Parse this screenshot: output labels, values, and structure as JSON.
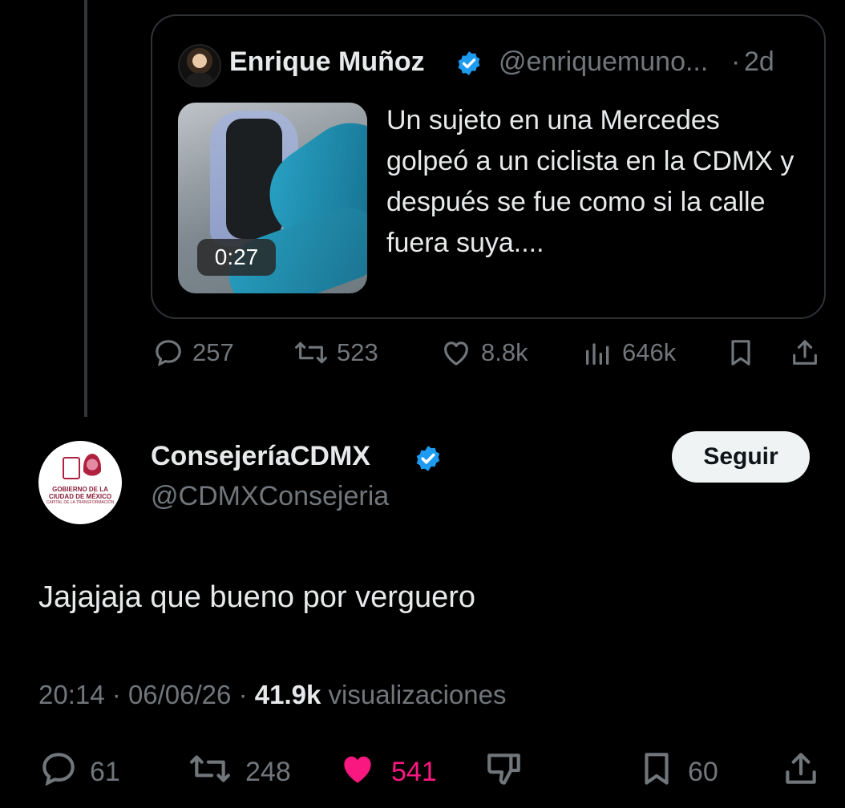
{
  "quoted_tweet": {
    "author_name": "Enrique Muñoz",
    "handle": "@enriquemuno...",
    "separator": "·",
    "time_ago": "2d",
    "video_duration": "0:27",
    "text": "Un sujeto en una Mercedes golpeó a un ciclista en la CDMX y después se fue como si la calle fuera suya....",
    "stats": {
      "replies": "257",
      "reposts": "523",
      "likes": "8.8k",
      "views": "646k"
    }
  },
  "reply": {
    "author_name": "ConsejeríaCDMX",
    "handle": "@CDMXConsejeria",
    "follow_label": "Seguir",
    "text": "Jajajaja que bueno por verguero",
    "time": "20:14",
    "separator": "·",
    "date": "06/06/26",
    "views_count": "41.9k",
    "views_label": "visualizaciones",
    "stats": {
      "replies": "61",
      "reposts": "248",
      "likes": "541",
      "bookmarks": "60"
    },
    "avatar_text": {
      "line1": "GOBIERNO DE LA",
      "line2": "CIUDAD DE MÉXICO",
      "line3": "CAPITAL DE LA TRANSFORMACIÓN"
    }
  },
  "colors": {
    "background": "#000000",
    "text": "#e7e9ea",
    "muted": "#71767b",
    "verified": "#1d9bf0",
    "like_active": "#f91880"
  },
  "icons": [
    "reply-icon",
    "repost-icon",
    "like-icon",
    "views-icon",
    "bookmark-icon",
    "share-icon",
    "dislike-icon",
    "verified-badge-icon"
  ]
}
